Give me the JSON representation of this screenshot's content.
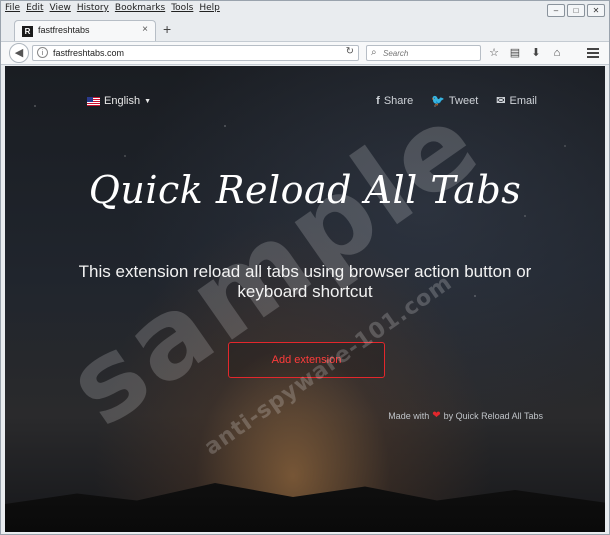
{
  "browser": {
    "menu": [
      "File",
      "Edit",
      "View",
      "History",
      "Bookmarks",
      "Tools",
      "Help"
    ],
    "tab_title": "fastfreshtabs",
    "new_tab": "+",
    "url": "fastfreshtabs.com",
    "search_placeholder": "Search",
    "window_controls": [
      "–",
      "□",
      "✕"
    ]
  },
  "page": {
    "language": "English",
    "social": {
      "share": "Share",
      "tweet": "Tweet",
      "email": "Email"
    },
    "headline": "Quick Reload All Tabs",
    "subtitle": "This extension reload all tabs using browser action button or keyboard shortcut",
    "cta": "Add extension",
    "footer": {
      "made_with": "Made with",
      "by": "by Quick Reload All Tabs"
    },
    "accent_color": "#e3272c"
  },
  "watermark": {
    "main": "sample",
    "site": "anti-spyware-101.com"
  }
}
